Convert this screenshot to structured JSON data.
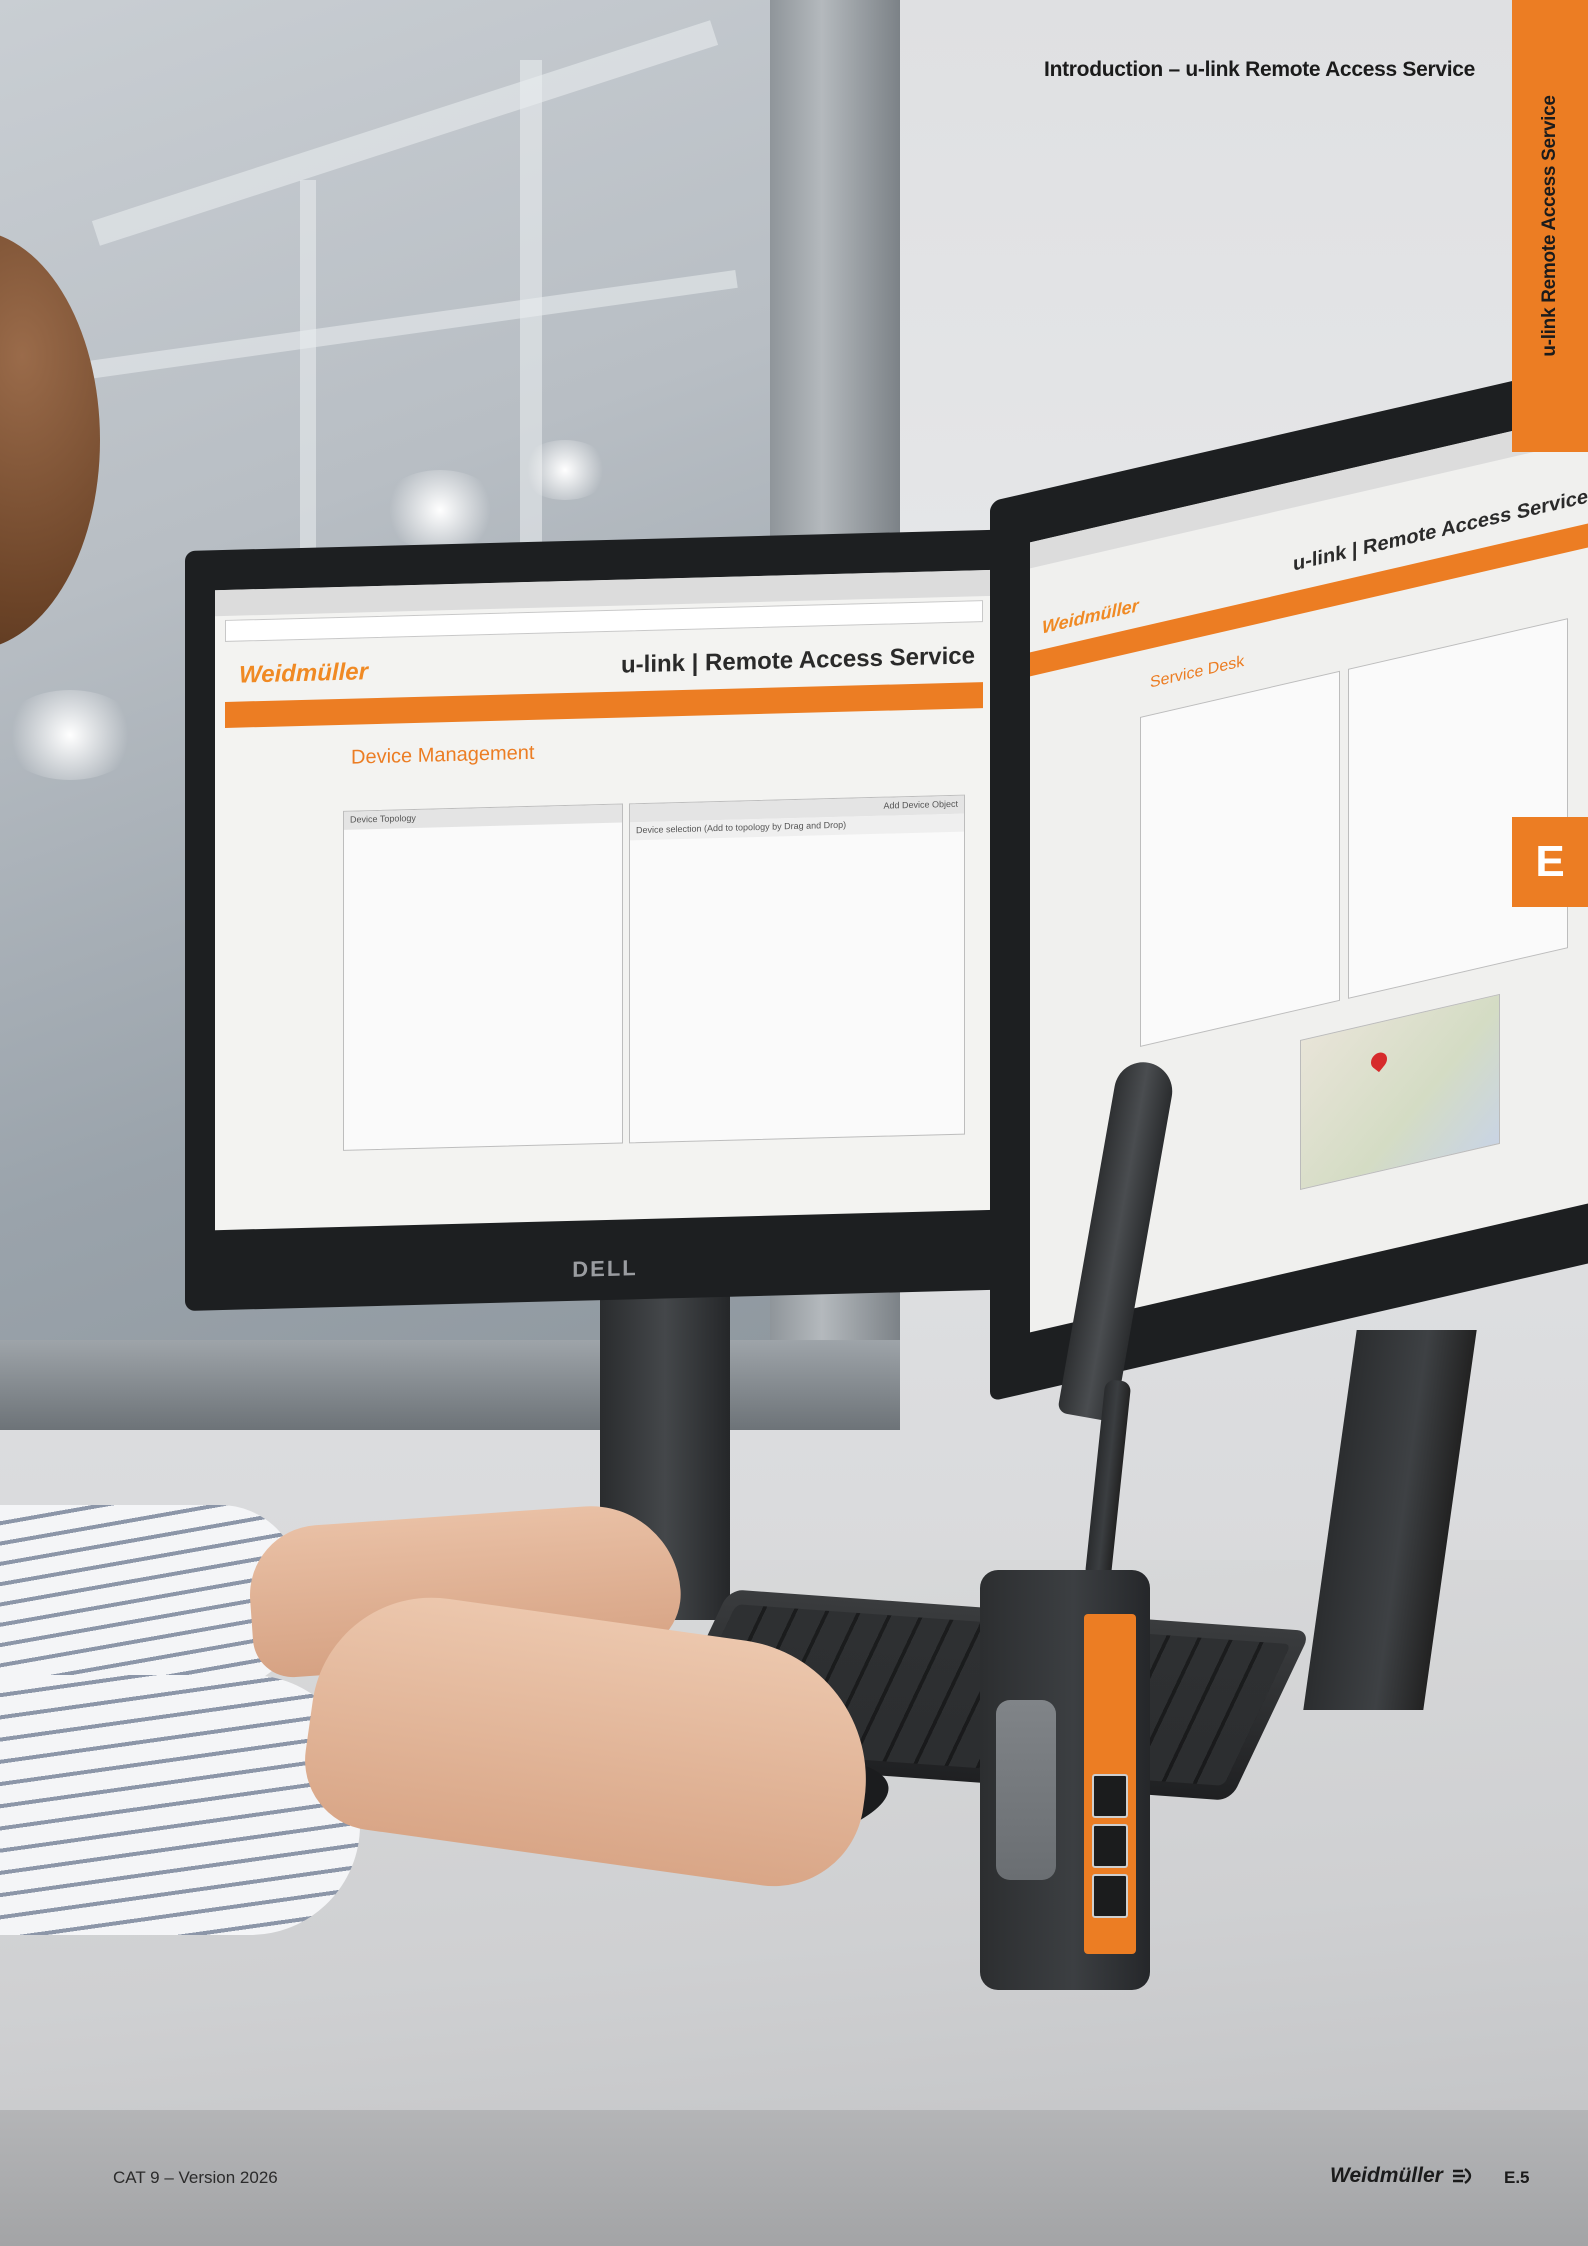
{
  "header": {
    "title": "Introduction – u-link Remote Access Service"
  },
  "side_tab": {
    "label": "u-link Remote Access Service",
    "section_letter": "E"
  },
  "photo": {
    "left_screen": {
      "logo": "Weidmüller",
      "app_title": "u-link | Remote Access Service",
      "page_heading": "Device Management",
      "panel_topology": "Device Topology",
      "panel_objects": "Add Device Object",
      "panel_selection": "Device selection (Add to topology by Drag and Drop)",
      "monitor_brand": "DELL"
    },
    "right_screen": {
      "logo": "Weidmüller",
      "app_title": "u-link | Remote Access Service",
      "page_heading": "Service Desk"
    }
  },
  "footer": {
    "catalogue": "CAT 9 – Version 2026",
    "brand": "Weidmüller",
    "page_number": "E.5"
  },
  "colors": {
    "accent_orange": "#ec7d23",
    "text_dark": "#1b1b1b"
  }
}
